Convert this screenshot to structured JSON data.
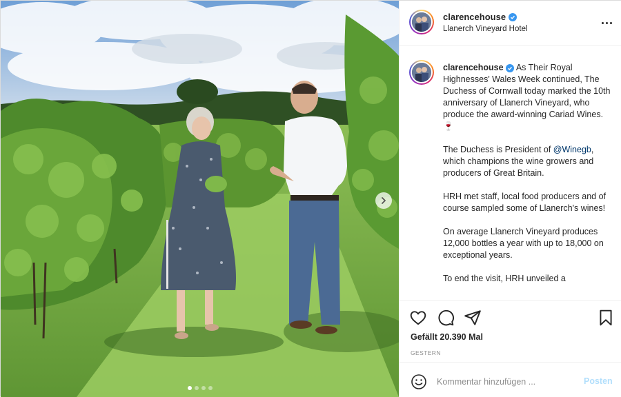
{
  "post": {
    "username": "clarencehouse",
    "location": "Llanerch Vineyard Hotel",
    "carousel": {
      "slide_count": 4,
      "active_index": 0
    }
  },
  "caption": {
    "username": "clarencehouse",
    "p1": "As Their Royal Highnesses' Wales Week continued, The Duchess of Cornwall today marked the 10th anniversary of Llanerch Vineyard, who produce the award-winning Cariad Wines. 🍷",
    "p2_before": "The Duchess is President of ",
    "p2_mention": "@Winegb",
    "p2_after": ", which champions the wine growers and producers of Great Britain.",
    "p3": "HRH met staff, local food producers and of course sampled some of Llanerch's wines!",
    "p4": "On average Llanerch Vineyard produces 12,000 bottles a year with up to 18,000 on exceptional years.",
    "p5": "To end the visit, HRH unveiled a"
  },
  "engagement": {
    "likes_text": "Gefällt 20.390 Mal",
    "date_text": "GESTERN"
  },
  "comment": {
    "placeholder": "Kommentar hinzufügen ...",
    "post_label": "Posten"
  },
  "icons": {
    "like": "heart-icon",
    "comment": "comment-icon",
    "share": "paper-plane-icon",
    "save": "bookmark-icon",
    "more": "more-options-icon",
    "emoji": "emoji-icon",
    "next": "chevron-right-icon",
    "verified": "verified-badge-icon"
  },
  "colors": {
    "verified": "#3897f0",
    "mention": "#00376b",
    "post_button": "#b2dffc"
  }
}
